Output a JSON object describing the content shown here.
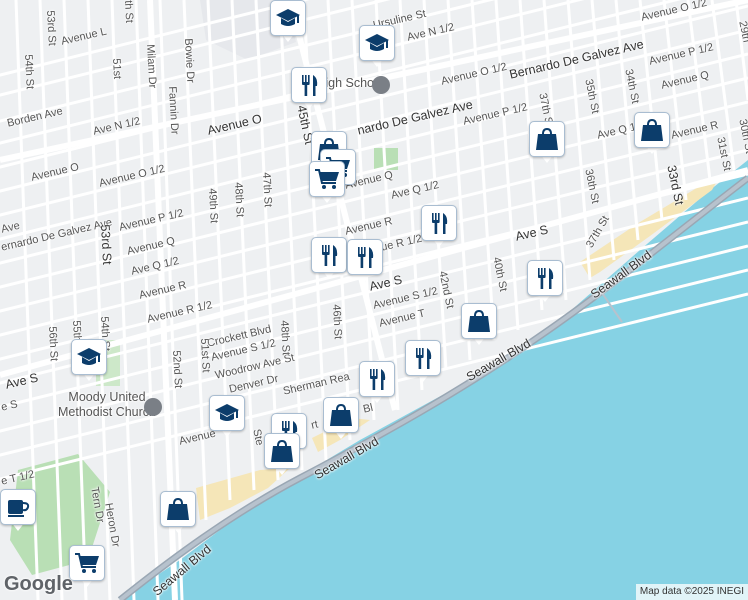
{
  "map": {
    "water_color": "#86d2e4",
    "land_color": "#eef0f2",
    "road_color": "#ffffff",
    "highway_color": "#9aa7b4",
    "park_color": "#b9dfb5",
    "beach_color": "#f5e6b8",
    "pin_icon_color": "#0c3d6b"
  },
  "labels": {
    "ursuline_st": "Ursuline St",
    "ave_n_half": "Ave N 1/2",
    "avenue_o_top": "Avenue O 1/2",
    "avenue_o_half_top": "Avenue O 1/2",
    "avenue_l": "Avenue L",
    "avenue_o_right": "Avenue O 1/2",
    "avenue_p_half_right": "Avenue P 1/2",
    "bernardo_top": "Bernardo De Galvez Ave",
    "ave_p_half_mid": "Avenue P 1/2",
    "avenue_q_right": "Avenue Q",
    "ave_q_half_right": "Ave Q 1/2",
    "avenue_r_right": "Avenue R",
    "borden_ave": "Borden Ave",
    "ave_n_half_left": "Ave N 1/2",
    "avenue_o_mid": "Avenue O",
    "bernardo_mid": "nardo De Galvez Ave",
    "avenue_o_left": "Avenue O",
    "avenue_o_half_left": "Avenue O 1/2",
    "avenue_q_mid": "Avenue Q",
    "ave_q_half_mid": "Ave Q 1/2",
    "ave_left": "Ave",
    "bernardo_left": "ernardo De Galvez Ave",
    "avenue_p_half_left": "Avenue P 1/2",
    "avenue_r_mid": "Avenue R",
    "ave_r_half": "ue R 1/2",
    "ave_s_right": "Ave S",
    "avenue_q_left": "Avenue Q",
    "ave_q_half_left": "Ave Q 1/2",
    "avenue_r_left": "Avenue R",
    "avenue_r_half_left": "Avenue R 1/2",
    "ave_s_mid": "Ave S",
    "avenue_s_half": "Avenue S 1/2",
    "avenue_t": "Avenue T",
    "crockett_blvd": "Crockett Blvd",
    "avenue_s_half_left": "Avenue S 1/2",
    "woodrow_ave": "Woodrow Ave St",
    "denver_dr": "Denver Dr",
    "sherman": "Sherman Rea",
    "ave_s_left": "Ave S",
    "ave_s_far_left": "e S",
    "avenue_u": "Avenue",
    "avenue_t_half": "e T 1/2",
    "heron_dr": "Heron Dr",
    "tern_dr": "Tern Dr",
    "st_53rd": "53rd St",
    "st_54th": "54th St",
    "st_51st": "51st",
    "milam_dr": "Milam Dr",
    "bowie_dr": "Bowie Dr",
    "fannin_dr": "Fannin Dr",
    "st_45th": "45th St",
    "st_49th": "49th St",
    "st_48th": "48th St",
    "st_47th": "47th St",
    "st_46th": "46th St",
    "st_48th_low": "48th St",
    "st_51st_low": "51st St",
    "st_52nd": "52nd St",
    "st_53rd_low": "53rd St",
    "st_54th_low": "54th St",
    "st_55th": "55th St",
    "st_56th": "56th St",
    "st_42nd": "42nd St",
    "st_40th": "40th St",
    "st_37th": "37th St",
    "st_37th_low": "37th St",
    "st_35th": "35th St",
    "st_34th": "34th St",
    "st_36th": "36th St",
    "st_33rd": "33rd St",
    "st_31st": "31st St",
    "st_30th": "30th St",
    "st_29th": "29th",
    "st_th": "th St",
    "seawall_1": "Seawall Blvd",
    "seawall_2": "Seawall Blvd",
    "seawall_3": "Seawall Blvd",
    "seawall_4": "Seawall Blvd",
    "ball_school": "Ball High School",
    "moody_church": "Moody United\nMethodist Church",
    "stewart": "Ste",
    "court": "rt",
    "blvd": "Bl"
  },
  "logo": "Google",
  "attribution": "Map data ©2025 INEGI",
  "pins": [
    {
      "icon": "school-icon",
      "name": "pin-school-top"
    },
    {
      "icon": "school-icon",
      "name": "pin-school-ursuline"
    },
    {
      "icon": "restaurant-icon",
      "name": "pin-restaurant-ball"
    },
    {
      "icon": "shopping-bag-icon",
      "name": "pin-shop-37th"
    },
    {
      "icon": "shopping-bag-icon",
      "name": "pin-shop-34th"
    },
    {
      "icon": "shopping-bag-icon",
      "name": "pin-shop-45th-a"
    },
    {
      "icon": "shopping-cart-icon",
      "name": "pin-cart-45th"
    },
    {
      "icon": "shopping-cart-icon",
      "name": "pin-cart-avenue-q"
    },
    {
      "icon": "restaurant-icon",
      "name": "pin-restaurant-q-half"
    },
    {
      "icon": "restaurant-icon",
      "name": "pin-restaurant-46th"
    },
    {
      "icon": "restaurant-icon",
      "name": "pin-restaurant-r-half"
    },
    {
      "icon": "restaurant-icon",
      "name": "pin-restaurant-ave-s"
    },
    {
      "icon": "shopping-bag-icon",
      "name": "pin-shop-42nd"
    },
    {
      "icon": "restaurant-icon",
      "name": "pin-restaurant-seawall"
    },
    {
      "icon": "school-icon",
      "name": "pin-school-54th"
    },
    {
      "icon": "restaurant-icon",
      "name": "pin-restaurant-sherman"
    },
    {
      "icon": "school-icon",
      "name": "pin-school-avenue-u"
    },
    {
      "icon": "restaurant-icon",
      "name": "pin-restaurant-stewart"
    },
    {
      "icon": "shopping-bag-icon",
      "name": "pin-shop-blvd"
    },
    {
      "icon": "shopping-bag-icon",
      "name": "pin-shop-seawall-low"
    },
    {
      "icon": "shopping-bag-icon",
      "name": "pin-shop-beach"
    },
    {
      "icon": "coffee-icon",
      "name": "pin-coffee-left"
    },
    {
      "icon": "shopping-cart-icon",
      "name": "pin-cart-bottom"
    }
  ]
}
